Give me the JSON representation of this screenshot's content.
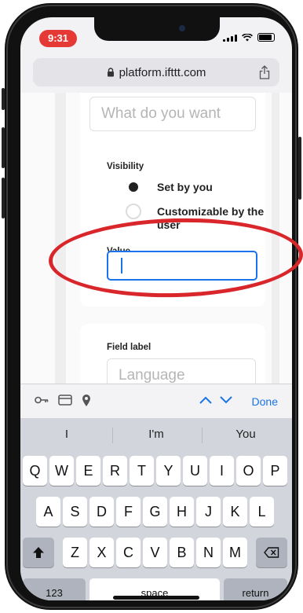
{
  "status_bar": {
    "time": "9:31"
  },
  "browser": {
    "url": "platform.ifttt.com"
  },
  "form": {
    "text_placeholder": "What do you want",
    "visibility_label": "Visibility",
    "visibility_options": [
      {
        "label": "Set by you",
        "selected": true
      },
      {
        "label": "Customizable by the user",
        "selected": false
      }
    ],
    "value_label": "Value",
    "value_input": "",
    "field_label_title": "Field label",
    "field_label_placeholder": "Language"
  },
  "annotation": {
    "color": "#d8262b",
    "shape": "ellipse"
  },
  "keyboard_accessory": {
    "done_label": "Done",
    "icons": [
      "key-icon",
      "card-icon",
      "location-pin-icon",
      "chevron-up-icon",
      "chevron-down-icon"
    ]
  },
  "keyboard": {
    "suggestions": [
      "I",
      "I'm",
      "You"
    ],
    "row1": [
      "Q",
      "W",
      "E",
      "R",
      "T",
      "Y",
      "U",
      "I",
      "O",
      "P"
    ],
    "row2": [
      "A",
      "S",
      "D",
      "F",
      "G",
      "H",
      "J",
      "K",
      "L"
    ],
    "row3": [
      "Z",
      "X",
      "C",
      "V",
      "B",
      "N",
      "M"
    ],
    "numbers_key": "123",
    "space_key": "space",
    "return_key": "return"
  },
  "colors": {
    "accent": "#1a73e8",
    "time_pill": "#e53935"
  }
}
